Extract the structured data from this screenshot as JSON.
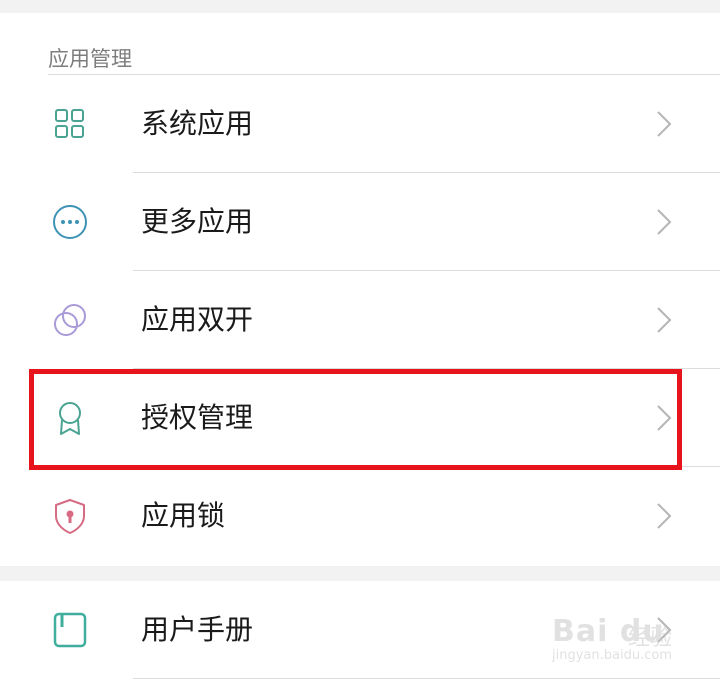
{
  "section": {
    "title": "应用管理"
  },
  "items": [
    {
      "label": "系统应用",
      "icon": "grid-icon"
    },
    {
      "label": "更多应用",
      "icon": "more-dots-icon"
    },
    {
      "label": "应用双开",
      "icon": "dual-circles-icon"
    },
    {
      "label": "授权管理",
      "icon": "award-ribbon-icon"
    },
    {
      "label": "应用锁",
      "icon": "shield-lock-icon"
    }
  ],
  "items2": [
    {
      "label": "用户手册",
      "icon": "manual-book-icon"
    }
  ],
  "watermark": {
    "brand": "Bai du",
    "sub": "经验",
    "url": "jingyan.baidu.com"
  },
  "colors": {
    "highlight": "#e8141b",
    "grid_icon": "#4aa392",
    "more_icon": "#3e93b5",
    "dual_icon": "#a99ad8",
    "award_icon": "#4aa392",
    "shield_icon": "#d66b83",
    "book_icon": "#3fae9d"
  }
}
